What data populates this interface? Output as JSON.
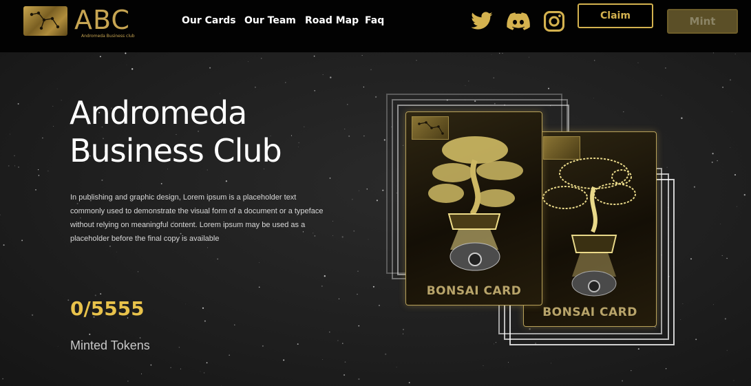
{
  "header": {
    "logo_text": "ABC",
    "logo_subtitle": "Andromeda Business club",
    "nav": [
      "Our Cards",
      "Our Team",
      "Road Map",
      "Faq"
    ],
    "social_icons": [
      "twitter-icon",
      "discord-icon",
      "instagram-icon"
    ],
    "claim_label": "Claim",
    "mint_label": "Mint"
  },
  "hero": {
    "title_line1": "Andromeda",
    "title_line2": "Business Club",
    "description": "In publishing and graphic design, Lorem ipsum is a placeholder text commonly used to demonstrate the visual form of a document or a typeface without relying on meaningful content. Lorem ipsum may be used as a placeholder before the final copy is available",
    "minted_count": "0/5555",
    "minted_label": "Minted Tokens"
  },
  "cards": [
    {
      "label": "BONSAI CARD"
    },
    {
      "label": "BONSAI CARD"
    }
  ],
  "colors": {
    "accent_gold": "#d4b24f",
    "counter_gold": "#e8c24b",
    "header_bg": "#020202"
  }
}
